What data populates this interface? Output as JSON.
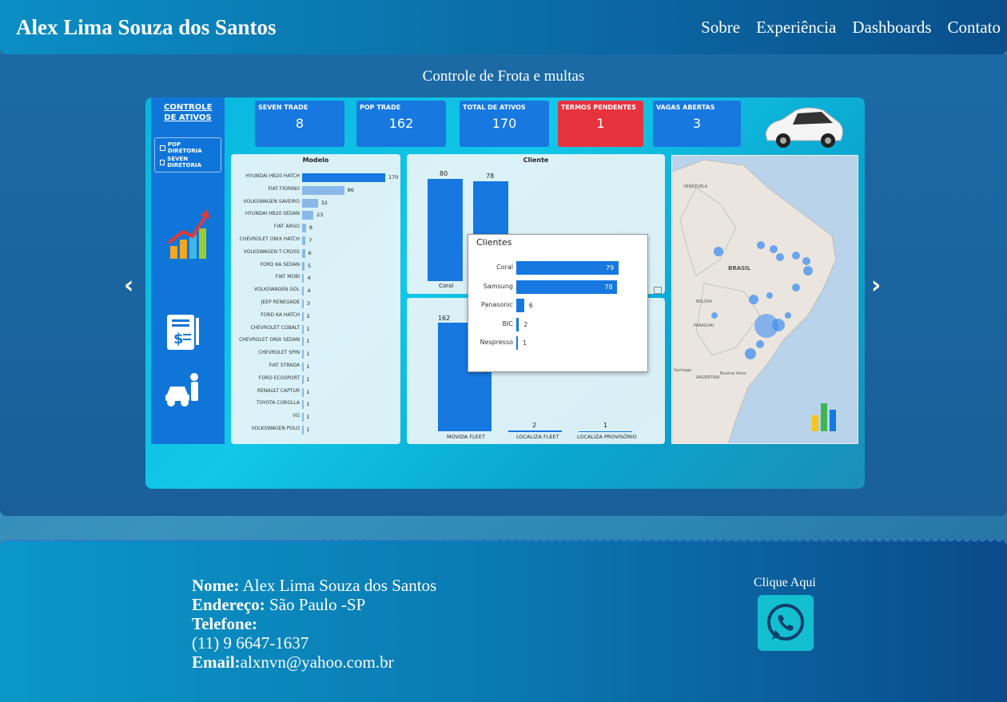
{
  "header": {
    "brand": "Alex Lima Souza dos Santos",
    "nav": [
      "Sobre",
      "Experiência",
      "Dashboards",
      "Contato"
    ]
  },
  "section": {
    "title": "Controle de Frota e multas"
  },
  "dashboard": {
    "side_title": "CONTROLE DE ATIVOS",
    "filters": [
      "POP DIRETORIA",
      "SEVEN DIRETORIA"
    ],
    "kpis": [
      {
        "label": "SEVEN TRADE",
        "value": "8"
      },
      {
        "label": "POP TRADE",
        "value": "162"
      },
      {
        "label": "TOTAL DE ATIVOS",
        "value": "170"
      },
      {
        "label": "TERMOS PENDENTES",
        "value": "1"
      },
      {
        "label": "VAGAS ABERTAS",
        "value": "3"
      }
    ],
    "modelo_title": "Modelo",
    "modelo": [
      {
        "label": "HYUNDAI HB20 HATCH",
        "value": "170"
      },
      {
        "label": "FIAT FIORINO",
        "value": "86"
      },
      {
        "label": "VOLKSWAGEN SAVEIRO",
        "value": "32"
      },
      {
        "label": "HYUNDAI HB20 SEDAN",
        "value": "23"
      },
      {
        "label": "FIAT ARGO",
        "value": "8"
      },
      {
        "label": "CHEVROLET ONIX HATCH",
        "value": "7"
      },
      {
        "label": "VOLKSWAGEN T-CROSS",
        "value": "6"
      },
      {
        "label": "FORD KA SEDAN",
        "value": "5"
      },
      {
        "label": "FIAT MOBI",
        "value": "4"
      },
      {
        "label": "VOLKSWAGEN GOL",
        "value": "4"
      },
      {
        "label": "JEEP RENEGADE",
        "value": "3"
      },
      {
        "label": "FORD KA HATCH",
        "value": "2"
      },
      {
        "label": "CHEVROLET COBALT",
        "value": "1"
      },
      {
        "label": "CHEVROLET ONIX SEDAN",
        "value": "1"
      },
      {
        "label": "CHEVROLET SPIN",
        "value": "1"
      },
      {
        "label": "FIAT STRADA",
        "value": "1"
      },
      {
        "label": "FORD ECOSPORT",
        "value": "1"
      },
      {
        "label": "RENAULT CAPTUR",
        "value": "1"
      },
      {
        "label": "TOYOTA COROLLA",
        "value": "1"
      },
      {
        "label": "VG",
        "value": "1"
      },
      {
        "label": "VOLKSWAGEN POLO",
        "value": "1"
      }
    ],
    "cliente_title": "Cliente",
    "cliente_top": {
      "v1": "80",
      "v2": "78",
      "cat1": "Coral"
    },
    "bottom": {
      "v1": "162",
      "cat1": "MOVIDA FLEET",
      "v2": "2",
      "cat2": "LOCALIZA FLEET",
      "v3": "1",
      "cat3": "LOCALIZA PROVISÓRIO"
    },
    "popup_title": "Clientes",
    "popup": [
      {
        "label": "Coral",
        "value": "79"
      },
      {
        "label": "Samsung",
        "value": "78"
      },
      {
        "label": "Panasonic",
        "value": "6"
      },
      {
        "label": "BIC",
        "value": "2"
      },
      {
        "label": "Nespresso",
        "value": "1"
      }
    ],
    "map_labels": {
      "brasil": "BRASIL",
      "venezuela": "VENEZUELA",
      "bolivia": "BOLÍVIA",
      "paraguai": "PARAGUAI",
      "argentina": "ARGENTINA",
      "santiago": "Santiago",
      "buenos_aires": "Buenos Aires"
    }
  },
  "footer": {
    "nome_label": "Nome:",
    "nome": " Alex Lima Souza dos Santos",
    "endereco_label": "Endereço:",
    "endereco": " São Paulo -SP",
    "telefone_label": "Telefone:",
    "telefone": "(11) 9 6647-1637",
    "email_label": "Email:",
    "email": "alxnvn@yahoo.com.br",
    "cta": "Clique Aqui"
  },
  "colors": {
    "accent": "#1778e0",
    "alert": "#e7333f",
    "whatsapp": "#13bfcf"
  }
}
